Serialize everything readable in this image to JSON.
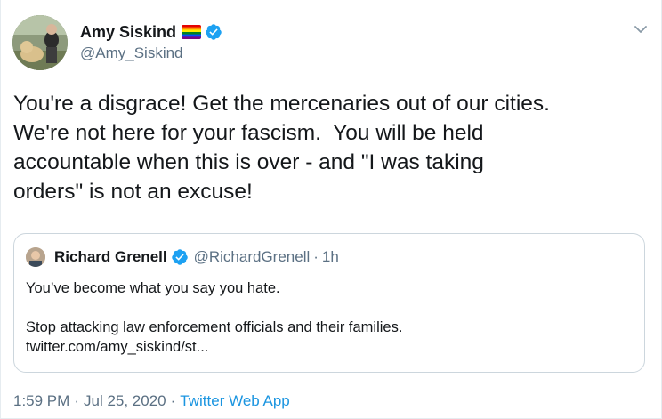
{
  "author": {
    "display_name": "Amy Siskind",
    "handle": "@Amy_Siskind",
    "flag_icon": "rainbow-flag-icon",
    "verified_icon": "verified-badge-icon",
    "verified_color": "#1da1f2"
  },
  "tweet": {
    "text": "You're a disgrace! Get the mercenaries out of our cities.\nWe're not here for your fascism.  You will be held\naccountable when this is over - and \"I was taking\norders\" is not an excuse!"
  },
  "quoted_tweet": {
    "display_name": "Richard Grenell",
    "handle": "@RichardGrenell",
    "separator": "·",
    "time": "1h",
    "line1": "You’ve become what you say you hate.",
    "line2": "Stop attacking law enforcement officials and their families.",
    "line3": "twitter.com/amy_siskind/st..."
  },
  "footer": {
    "time": "1:59 PM",
    "separator": "·",
    "date": "Jul 25, 2020",
    "separator2": "·",
    "app": "Twitter Web App",
    "app_color": "#1b95e0"
  },
  "menu": {
    "caret_icon": "chevron-down-icon"
  }
}
